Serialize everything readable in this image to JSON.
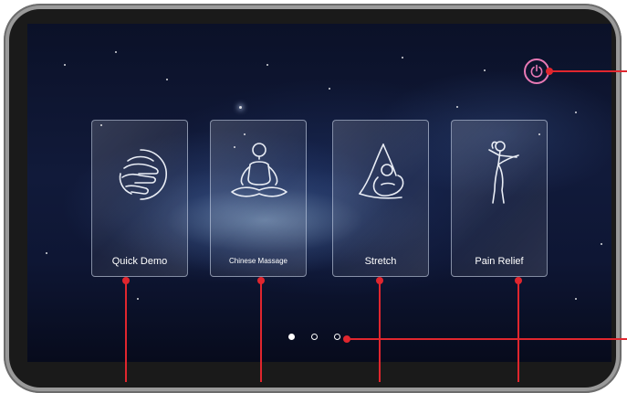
{
  "screen": {
    "power_button": {
      "icon": "power-icon",
      "color": "#e879b5"
    },
    "mode_cards": [
      {
        "label": "Quick Demo",
        "icon": "hand-wave-icon"
      },
      {
        "label": "Chinese Massage",
        "icon": "meditation-pose-icon"
      },
      {
        "label": "Stretch",
        "icon": "stretch-pose-icon"
      },
      {
        "label": "Pain Relief",
        "icon": "kick-pose-icon"
      }
    ],
    "page_indicator": {
      "pages": 3,
      "current": 1
    }
  },
  "annotation": {
    "leader_color": "#e0262e"
  }
}
